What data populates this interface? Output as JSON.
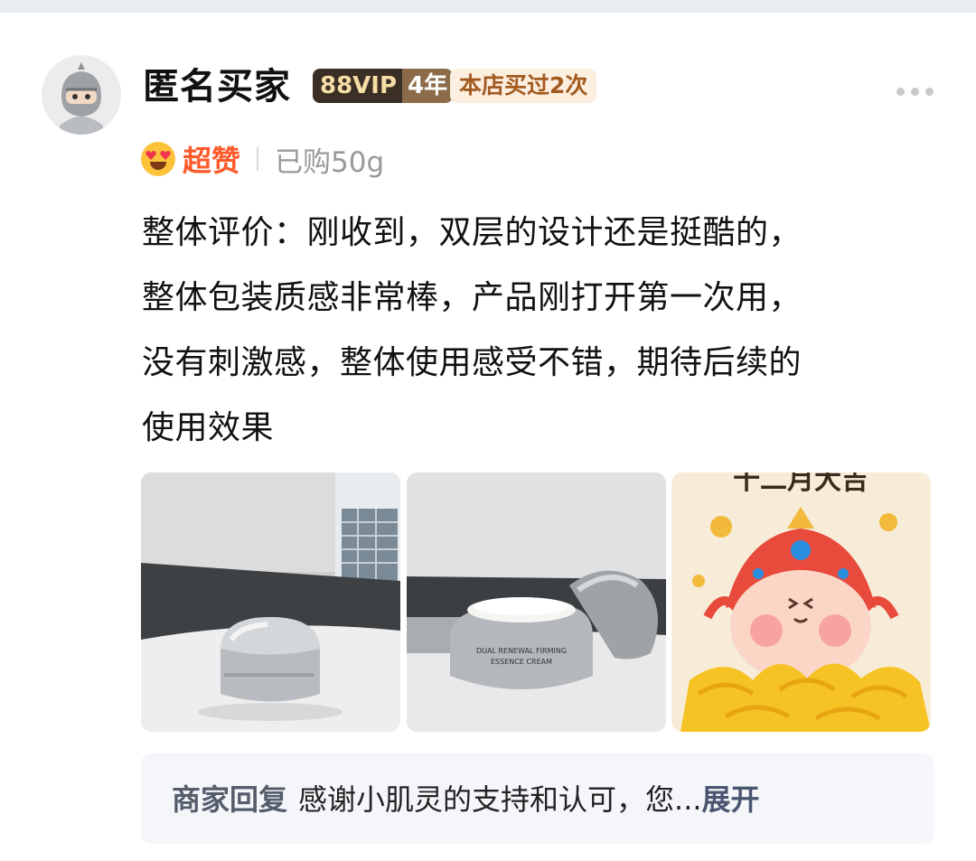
{
  "user": {
    "name": "匿名买家",
    "vip_label": "88VIP",
    "vip_years": "4年",
    "shop_badge": "本店买过2次"
  },
  "rating": {
    "label": "超赞",
    "purchased": "已购50g"
  },
  "review": {
    "lines": [
      "整体评价：刚收到，双层的设计还是挺酷的，",
      "整体包装质感非常棒，产品刚打开第一次用，",
      "没有刺激感，整体使用感受不错，期待后续的",
      "使用效果"
    ]
  },
  "photos": [
    {
      "icon": "cream-jar-closed-photo"
    },
    {
      "icon": "cream-jar-open-photo",
      "jar_text_1": "DUAL RENEWAL FIRMING",
      "jar_text_2": "ESSENCE CREAM"
    },
    {
      "icon": "cartoon-god-of-wealth-photo",
      "title": "十二月大吉"
    }
  ],
  "reply": {
    "label": "商家回复",
    "content": "感谢小肌灵的支持和认可，您...",
    "expand": "展开"
  },
  "colors": {
    "accent": "#ff5a2a",
    "vip_bg": "#3b2f25",
    "shop_badge_bg": "#fcefe0",
    "reply_bg": "#f4f6fa"
  }
}
